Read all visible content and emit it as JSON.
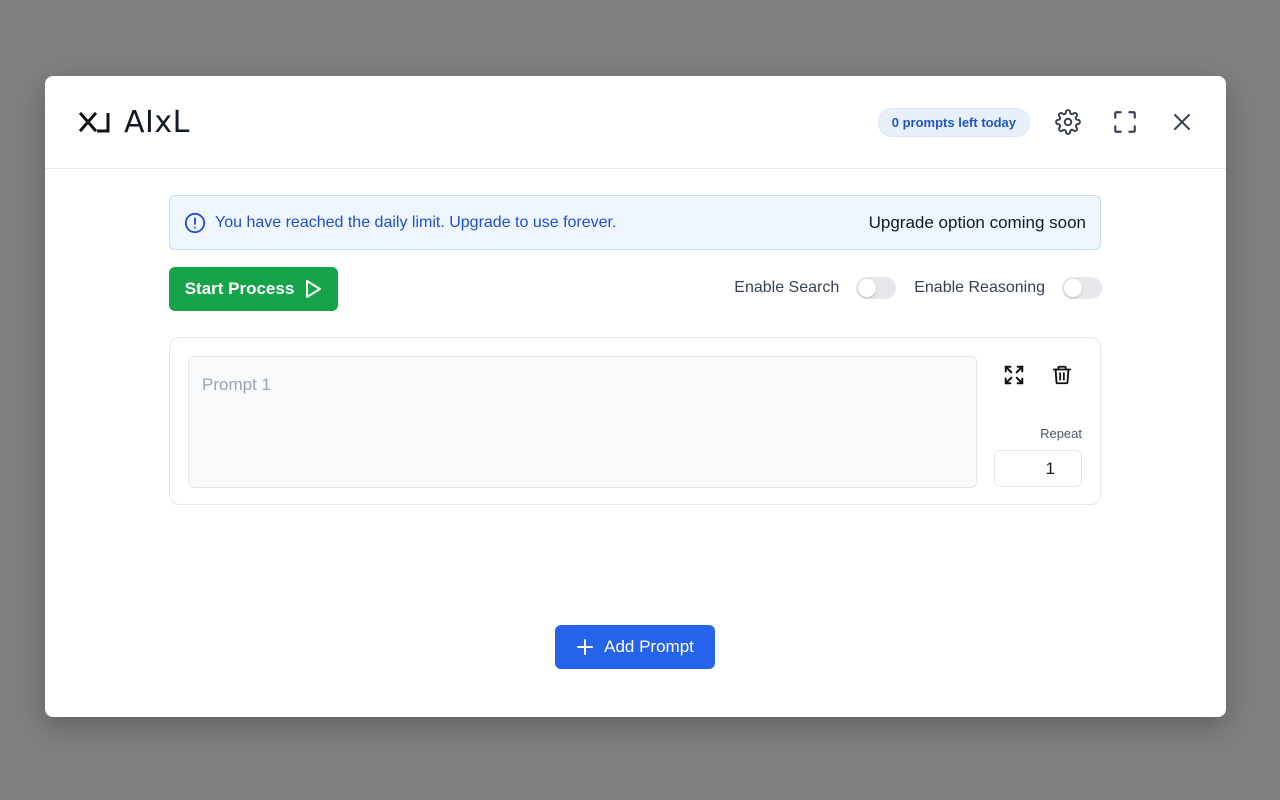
{
  "app": {
    "title": "AIxL",
    "logo_icon": "xl-logo-icon"
  },
  "header": {
    "badge": "0 prompts left today",
    "icons": [
      "gear-icon",
      "fullscreen-icon",
      "close-icon"
    ]
  },
  "alert": {
    "icon": "info-icon",
    "message": "You have reached the daily limit. Upgrade to use forever.",
    "right_text": "Upgrade option coming soon"
  },
  "actions": {
    "start_label": "Start Process",
    "start_icon": "play-icon"
  },
  "toggles": [
    {
      "label": "Enable Search",
      "enabled": false
    },
    {
      "label": "Enable Reasoning",
      "enabled": false
    }
  ],
  "prompts": [
    {
      "placeholder": "Prompt 1",
      "value": "",
      "repeat_label": "Repeat",
      "repeat_value": "1"
    }
  ],
  "add_prompt": {
    "label": "Add Prompt",
    "icon": "plus-icon"
  },
  "colors": {
    "overlay": "#808080",
    "start_button": "#16a34a",
    "add_button": "#2563eb",
    "alert_text": "#1d4ed8",
    "badge_text": "#1e56c4"
  }
}
